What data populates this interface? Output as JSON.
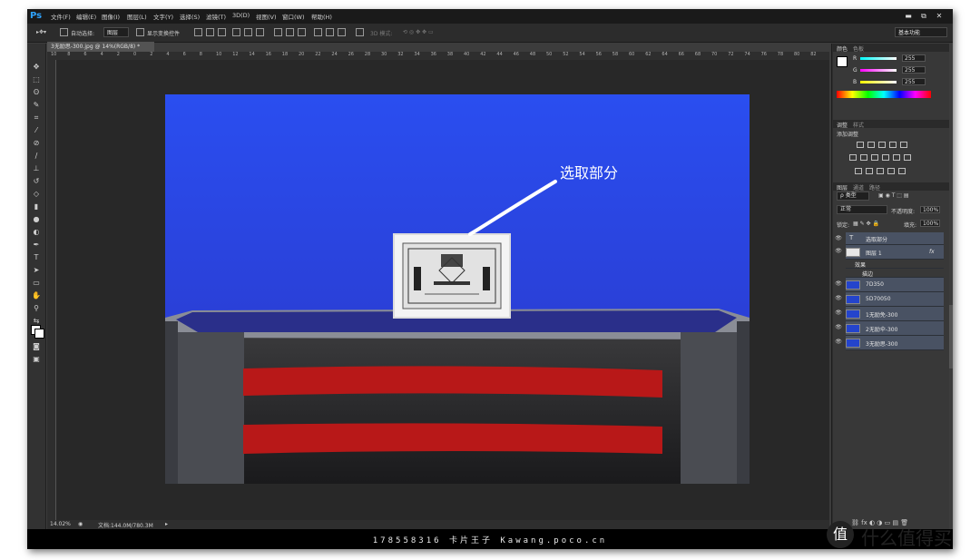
{
  "app": {
    "logo": "Ps"
  },
  "menu": [
    "文件(F)",
    "编辑(E)",
    "图像(I)",
    "图层(L)",
    "文字(Y)",
    "选择(S)",
    "滤镜(T)",
    "3D(D)",
    "视图(V)",
    "窗口(W)",
    "帮助(H)"
  ],
  "window_buttons": [
    "▬",
    "⧉",
    "✕"
  ],
  "options": {
    "auto_select_label": "自动选择:",
    "auto_select_value": "图层",
    "show_transform_label": "显示变换控件",
    "mode_3d_label": "3D 模式:",
    "workspace": "基本功能"
  },
  "document": {
    "tab_title": "3无励思-300.jpg @ 14%(RGB/8) *",
    "zoom": "14.02%",
    "doc_size": "文档:144.0M/780.3M",
    "ruler_ticks": [
      "10",
      "8",
      "6",
      "4",
      "2",
      "0",
      "2",
      "4",
      "6",
      "8",
      "10",
      "12",
      "14",
      "16",
      "18",
      "20",
      "22",
      "24",
      "26",
      "28",
      "30",
      "32",
      "34",
      "36",
      "38",
      "40",
      "42",
      "44",
      "46",
      "48",
      "50",
      "52",
      "54",
      "56",
      "58",
      "60",
      "62",
      "64",
      "66",
      "68",
      "70",
      "72",
      "74",
      "76",
      "78",
      "80",
      "82"
    ]
  },
  "image_annotation": "选取部分",
  "color_panel": {
    "tabs": [
      "颜色",
      "色板"
    ],
    "channels": [
      {
        "label": "R",
        "value": "255"
      },
      {
        "label": "G",
        "value": "255"
      },
      {
        "label": "B",
        "value": "255"
      }
    ]
  },
  "adjust_panel": {
    "tabs": [
      "调整",
      "样式"
    ],
    "title": "添加调整"
  },
  "layers_panel": {
    "tabs": [
      "图层",
      "通道",
      "路径"
    ],
    "filter_label": "ρ 类型",
    "blend_mode": "正常",
    "opacity_label": "不透明度:",
    "opacity_value": "100%",
    "lock_label": "锁定:",
    "fill_label": "填充:",
    "fill_value": "100%",
    "layers": [
      {
        "name": "选取部分",
        "kind": "text"
      },
      {
        "name": "图层 1",
        "kind": "image"
      },
      {
        "name": "效果",
        "kind": "effect"
      },
      {
        "name": "描边",
        "kind": "effect-item"
      },
      {
        "name": "7D350",
        "kind": "image"
      },
      {
        "name": "5D70050",
        "kind": "image"
      },
      {
        "name": "1无励免-300",
        "kind": "image"
      },
      {
        "name": "2无励伞-300",
        "kind": "image"
      },
      {
        "name": "3无励思-300",
        "kind": "image"
      }
    ],
    "fx_label": "fx"
  },
  "footer": {
    "caption": "178558316  卡片王子  Kawang.poco.cn"
  },
  "watermark": {
    "symbol": "值",
    "text": "什么值得买"
  }
}
